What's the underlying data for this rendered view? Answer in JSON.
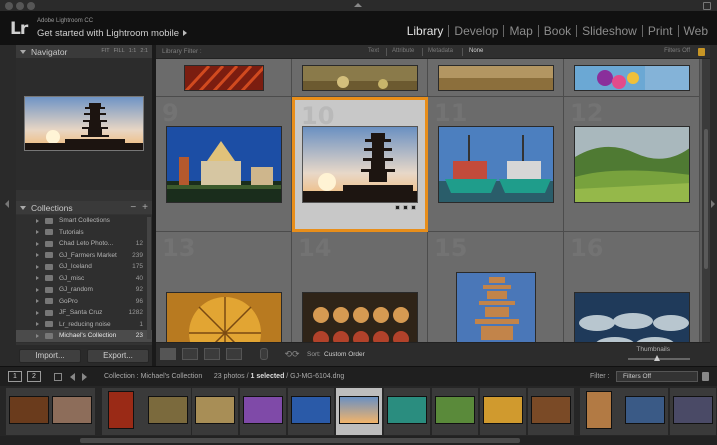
{
  "app": {
    "brand": "Adobe Lightroom CC",
    "subtitle": "Get started with Lightroom mobile",
    "logo": "Lr"
  },
  "modules": [
    {
      "label": "Library",
      "active": true
    },
    {
      "label": "Develop",
      "active": false
    },
    {
      "label": "Map",
      "active": false
    },
    {
      "label": "Book",
      "active": false
    },
    {
      "label": "Slideshow",
      "active": false
    },
    {
      "label": "Print",
      "active": false
    },
    {
      "label": "Web",
      "active": false
    }
  ],
  "navigator": {
    "title": "Navigator",
    "zoom_options": [
      "FIT",
      "FILL",
      "1:1",
      "2:1"
    ]
  },
  "collections": {
    "title": "Collections",
    "add": "+",
    "remove": "−",
    "items": [
      {
        "name": "Smart Collections",
        "count": ""
      },
      {
        "name": "Tutorials",
        "count": ""
      },
      {
        "name": "Chad Leto Photo...",
        "count": "12"
      },
      {
        "name": "GJ_Farmers Market",
        "count": "239"
      },
      {
        "name": "GJ_Iceland",
        "count": "175"
      },
      {
        "name": "GJ_misc",
        "count": "40"
      },
      {
        "name": "GJ_random",
        "count": "92"
      },
      {
        "name": "GoPro",
        "count": "96"
      },
      {
        "name": "JF_Santa Cruz",
        "count": "1282"
      },
      {
        "name": "Lr_reducing noise",
        "count": "1"
      },
      {
        "name": "Michael's Collection",
        "count": "23",
        "selected": true
      }
    ]
  },
  "buttons": {
    "import": "Import...",
    "export": "Export..."
  },
  "filter": {
    "label": "Library Filter :",
    "tabs": [
      "Text",
      "Attribute",
      "Metadata",
      "None"
    ],
    "active_tab": "None",
    "status": "Filters Off"
  },
  "grid": {
    "numbers": [
      "9",
      "10",
      "11",
      "12",
      "13",
      "14",
      "15",
      "16"
    ],
    "selected_index": 10
  },
  "toolbar": {
    "sort_label": "Sort:",
    "sort_value": "Custom Order",
    "thumbnails_label": "Thumbnails"
  },
  "filmstrip_bar": {
    "monitor_1": "1",
    "monitor_2": "2",
    "source": "Collection : Michael's Collection",
    "count": "23 photos /",
    "selected": "1 selected",
    "file": "/ GJ-MG-6104.dng",
    "filter_label": "Filter :",
    "filter_value": "Filters Off"
  },
  "colors": {
    "selection": "#e88e1a",
    "active_module": "#e2e2e2",
    "lock": "#c79525"
  },
  "icons": {
    "grid_view": "grid-view-icon",
    "loupe_view": "loupe-view-icon",
    "compare_view": "compare-view-icon",
    "survey_view": "survey-view-icon",
    "spray": "painter-icon",
    "rotate": "rotate-icon"
  }
}
